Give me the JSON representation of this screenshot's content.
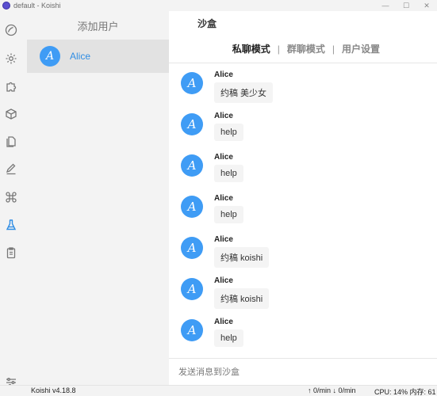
{
  "window": {
    "title": "default - Koishi",
    "minimize_glyph": "—",
    "maximize_glyph": "☐",
    "close_glyph": "✕"
  },
  "activity_bar": {
    "items": [
      {
        "icon": "dashboard-icon"
      },
      {
        "icon": "gear-icon"
      },
      {
        "icon": "puzzle-icon"
      },
      {
        "icon": "package-icon"
      },
      {
        "icon": "files-icon"
      },
      {
        "icon": "edit-icon"
      },
      {
        "icon": "command-icon"
      },
      {
        "icon": "flask-icon",
        "active": true
      },
      {
        "icon": "clipboard-icon"
      }
    ],
    "bottom_icon": "settings-sliders-icon"
  },
  "user_panel": {
    "add_user_label": "添加用户",
    "users": [
      {
        "avatar_letter": "A",
        "name": "Alice",
        "selected": true
      }
    ]
  },
  "main": {
    "title": "沙盒",
    "modes": [
      {
        "label": "私聊模式",
        "active": true
      },
      {
        "label": "群聊模式",
        "active": false
      },
      {
        "label": "用户设置",
        "active": false
      }
    ],
    "mode_separator": "|",
    "messages": [
      {
        "author": "Alice",
        "avatar_letter": "A",
        "text": "约稿 美少女"
      },
      {
        "author": "Alice",
        "avatar_letter": "A",
        "text": "help"
      },
      {
        "author": "Alice",
        "avatar_letter": "A",
        "text": "help"
      },
      {
        "author": "Alice",
        "avatar_letter": "A",
        "text": "help"
      },
      {
        "author": "Alice",
        "avatar_letter": "A",
        "text": "约稿 koishi"
      },
      {
        "author": "Alice",
        "avatar_letter": "A",
        "text": "约稿 koishi"
      },
      {
        "author": "Alice",
        "avatar_letter": "A",
        "text": "help"
      }
    ],
    "input_placeholder": "发送消息到沙盒"
  },
  "status_bar": {
    "version": "Koishi v4.18.8",
    "rate": "↑ 0/min  ↓ 0/min",
    "cpu": "CPU: 14%  内存: 61"
  },
  "colors": {
    "accent": "#3f9cf5",
    "selected_name": "#2f8de4",
    "active_icon": "#2f8de4"
  }
}
